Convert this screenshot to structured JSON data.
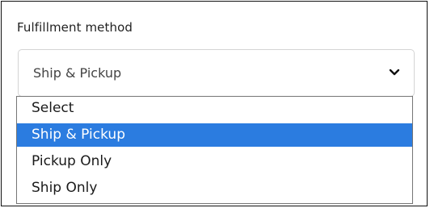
{
  "field": {
    "label": "Fulfillment method",
    "current_value": "Ship & Pickup",
    "chevron_icon": "chevron-down-icon"
  },
  "dropdown": {
    "options": [
      {
        "label": "Select",
        "selected": false
      },
      {
        "label": "Ship & Pickup",
        "selected": true
      },
      {
        "label": "Pickup Only",
        "selected": false
      },
      {
        "label": "Ship Only",
        "selected": false
      }
    ],
    "highlight_color": "#2b7ce0"
  }
}
